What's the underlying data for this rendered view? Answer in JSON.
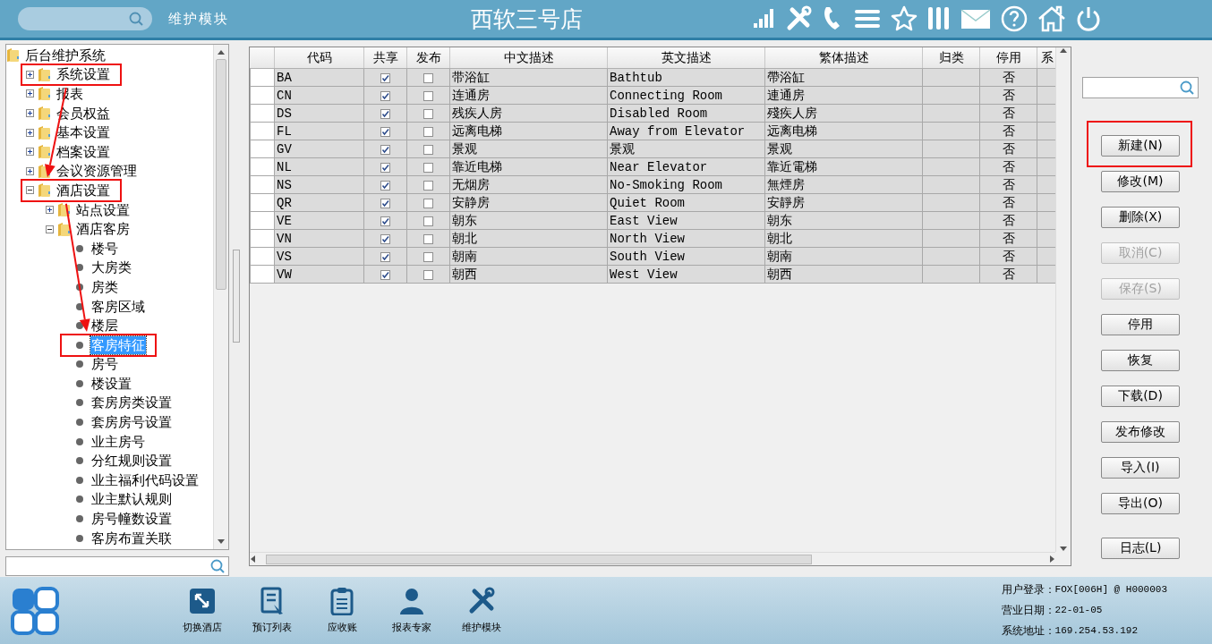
{
  "header": {
    "module_label": "维护模块",
    "title": "西软三号店"
  },
  "tree": {
    "items": [
      {
        "label": "后台维护系统",
        "kind": "root",
        "selected": false,
        "children": [
          {
            "label": "系统设置",
            "kind": "folder",
            "expanded": false,
            "selected": false,
            "highlighted": true
          },
          {
            "label": "报表",
            "kind": "folder",
            "expanded": false,
            "selected": false
          },
          {
            "label": "会员权益",
            "kind": "folder",
            "expanded": false,
            "selected": false
          },
          {
            "label": "基本设置",
            "kind": "folder",
            "expanded": false,
            "selected": false
          },
          {
            "label": "档案设置",
            "kind": "folder",
            "expanded": false,
            "selected": false
          },
          {
            "label": "会议资源管理",
            "kind": "folder",
            "expanded": false,
            "selected": false
          },
          {
            "label": "酒店设置",
            "kind": "folder",
            "expanded": true,
            "selected": false,
            "highlighted": true,
            "children": [
              {
                "label": "站点设置",
                "kind": "folder",
                "expanded": false,
                "selected": false
              },
              {
                "label": "酒店客房",
                "kind": "folder",
                "expanded": true,
                "selected": false,
                "children": [
                  {
                    "label": "楼号",
                    "kind": "leaf",
                    "selected": false
                  },
                  {
                    "label": "大房类",
                    "kind": "leaf",
                    "selected": false
                  },
                  {
                    "label": "房类",
                    "kind": "leaf",
                    "selected": false
                  },
                  {
                    "label": "客房区域",
                    "kind": "leaf",
                    "selected": false
                  },
                  {
                    "label": "楼层",
                    "kind": "leaf",
                    "selected": false
                  },
                  {
                    "label": "客房特征",
                    "kind": "leaf",
                    "selected": true,
                    "highlighted": true
                  },
                  {
                    "label": "房号",
                    "kind": "leaf",
                    "selected": false
                  },
                  {
                    "label": "楼设置",
                    "kind": "leaf",
                    "selected": false
                  },
                  {
                    "label": "套房房类设置",
                    "kind": "leaf",
                    "selected": false
                  },
                  {
                    "label": "套房房号设置",
                    "kind": "leaf",
                    "selected": false
                  },
                  {
                    "label": "业主房号",
                    "kind": "leaf",
                    "selected": false
                  },
                  {
                    "label": "分红规则设置",
                    "kind": "leaf",
                    "selected": false
                  },
                  {
                    "label": "业主福利代码设置",
                    "kind": "leaf",
                    "selected": false
                  },
                  {
                    "label": "业主默认规则",
                    "kind": "leaf",
                    "selected": false
                  },
                  {
                    "label": "房号幢数设置",
                    "kind": "leaf",
                    "selected": false
                  },
                  {
                    "label": "客房布置关联",
                    "kind": "leaf",
                    "selected": false
                  }
                ]
              }
            ]
          }
        ]
      }
    ]
  },
  "table": {
    "columns": [
      "代码",
      "共享",
      "发布",
      "中文描述",
      "英文描述",
      "繁体描述",
      "归类",
      "停用",
      "系"
    ],
    "rows": [
      {
        "code": "BA",
        "shared": true,
        "published": false,
        "chinese": "带浴缸",
        "english": "Bathtub",
        "traditional": "帶浴缸",
        "disabled": "否"
      },
      {
        "code": "CN",
        "shared": true,
        "published": false,
        "chinese": "连通房",
        "english": "Connecting Room",
        "traditional": "連通房",
        "disabled": "否"
      },
      {
        "code": "DS",
        "shared": true,
        "published": false,
        "chinese": "残疾人房",
        "english": "Disabled Room",
        "traditional": "殘疾人房",
        "disabled": "否"
      },
      {
        "code": "FL",
        "shared": true,
        "published": false,
        "chinese": "远离电梯",
        "english": "Away from Elevator",
        "traditional": "远离电梯",
        "disabled": "否"
      },
      {
        "code": "GV",
        "shared": true,
        "published": false,
        "chinese": "景观",
        "english": "景观",
        "traditional": "景观",
        "disabled": "否"
      },
      {
        "code": "NL",
        "shared": true,
        "published": false,
        "chinese": "靠近电梯",
        "english": "Near Elevator",
        "traditional": "靠近電梯",
        "disabled": "否"
      },
      {
        "code": "NS",
        "shared": true,
        "published": false,
        "chinese": "无烟房",
        "english": "No-Smoking Room",
        "traditional": "無煙房",
        "disabled": "否"
      },
      {
        "code": "QR",
        "shared": true,
        "published": false,
        "chinese": "安静房",
        "english": "Quiet Room",
        "traditional": "安靜房",
        "disabled": "否"
      },
      {
        "code": "VE",
        "shared": true,
        "published": false,
        "chinese": "朝东",
        "english": "East View",
        "traditional": "朝东",
        "disabled": "否"
      },
      {
        "code": "VN",
        "shared": true,
        "published": false,
        "chinese": "朝北",
        "english": "North View",
        "traditional": "朝北",
        "disabled": "否"
      },
      {
        "code": "VS",
        "shared": true,
        "published": false,
        "chinese": "朝南",
        "english": "South View",
        "traditional": "朝南",
        "disabled": "否"
      },
      {
        "code": "VW",
        "shared": true,
        "published": false,
        "chinese": "朝西",
        "english": "West View",
        "traditional": "朝西",
        "disabled": "否"
      }
    ]
  },
  "actions": [
    {
      "label": "新建(N)",
      "disabled": false,
      "highlighted": true
    },
    {
      "label": "修改(M)",
      "disabled": false
    },
    {
      "label": "删除(X)",
      "disabled": false
    },
    {
      "label": "取消(C)",
      "disabled": true
    },
    {
      "label": "保存(S)",
      "disabled": true
    },
    {
      "label": "停用",
      "disabled": false
    },
    {
      "label": "恢复",
      "disabled": false
    },
    {
      "label": "下载(D)",
      "disabled": false
    },
    {
      "label": "发布修改",
      "disabled": false
    },
    {
      "label": "导入(I)",
      "disabled": false
    },
    {
      "label": "导出(O)",
      "disabled": false
    },
    {
      "label": "日志(L)",
      "disabled": false
    }
  ],
  "taskbar": [
    {
      "label": "切换酒店",
      "kind": "switch"
    },
    {
      "label": "预订列表",
      "kind": "bookings"
    },
    {
      "label": "应收账",
      "kind": "receivables"
    },
    {
      "label": "报表专家",
      "kind": "reports"
    },
    {
      "label": "维护模块",
      "kind": "maintenance"
    }
  ],
  "status": [
    {
      "label": "用户登录：",
      "value": "FOX[006H] @ H000003"
    },
    {
      "label": "营业日期：",
      "value": "22-01-05"
    },
    {
      "label": "系统地址：",
      "value": "169.254.53.192"
    }
  ]
}
